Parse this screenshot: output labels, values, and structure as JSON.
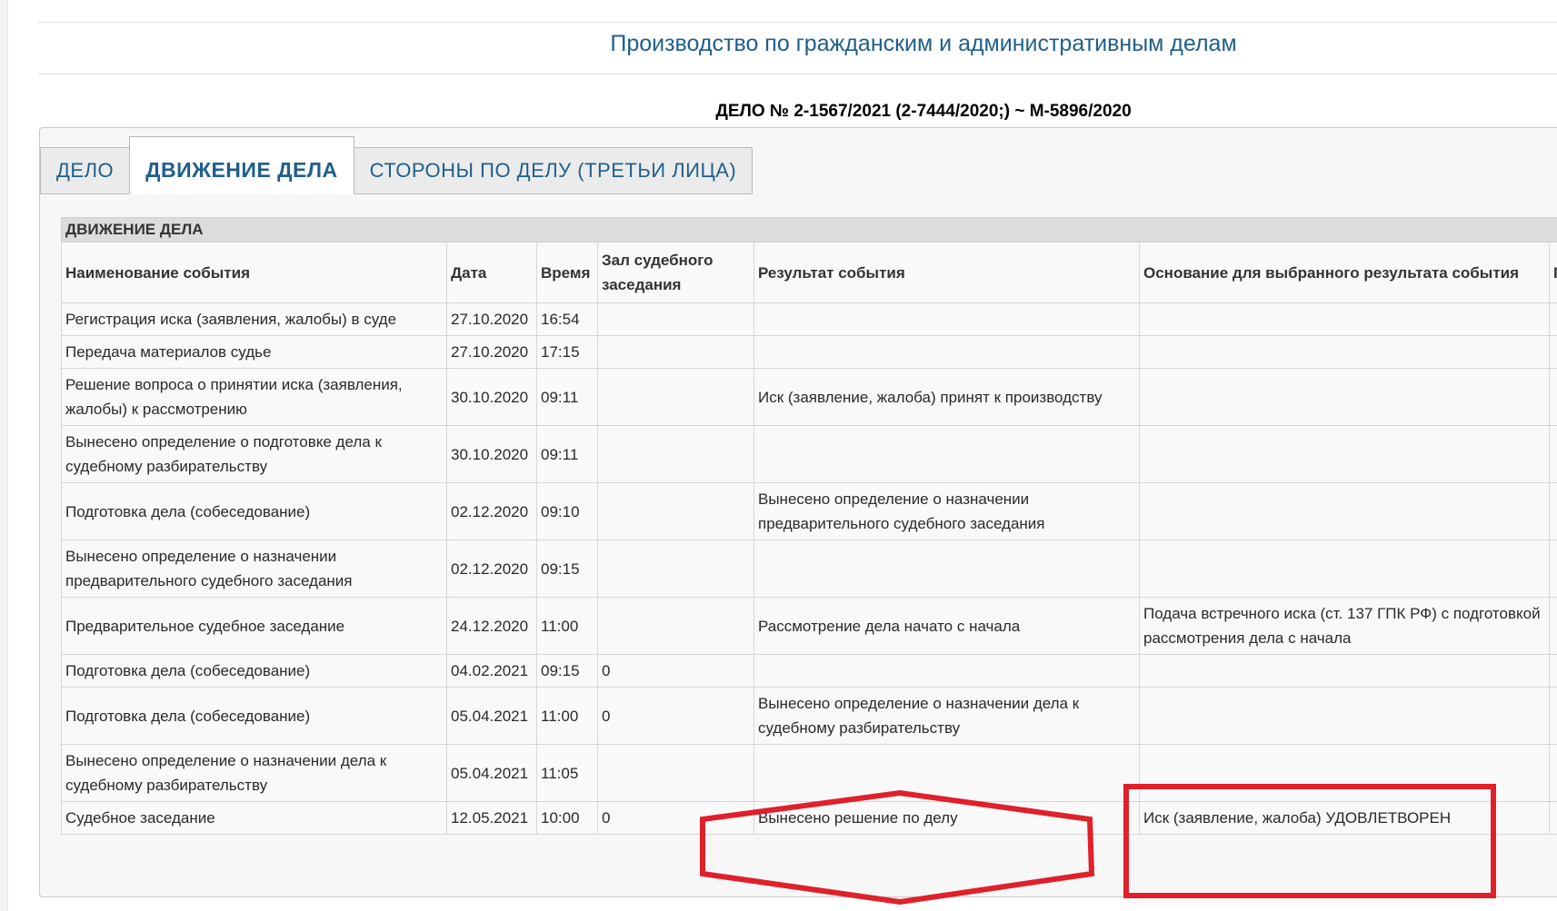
{
  "header": {
    "title": "Производство по гражданским и административным делам",
    "case_number": "ДЕЛО № 2-1567/2021 (2-7444/2020;) ~ М-5896/2020"
  },
  "tabs": [
    {
      "label": "ДЕЛО",
      "active": false
    },
    {
      "label": "ДВИЖЕНИЕ ДЕЛА",
      "active": true
    },
    {
      "label": "СТОРОНЫ ПО ДЕЛУ (ТРЕТЬИ ЛИЦА)",
      "active": false
    }
  ],
  "table": {
    "caption": "ДВИЖЕНИЕ ДЕЛА",
    "columns": [
      "Наименование события",
      "Дата",
      "Время",
      "Зал судебного заседания",
      "Результат события",
      "Основание для выбранного результата события",
      "П"
    ],
    "rows": [
      {
        "event": "Регистрация иска (заявления, жалобы) в суде",
        "date": "27.10.2020",
        "time": "16:54",
        "room": "",
        "result": "",
        "basis": ""
      },
      {
        "event": "Передача материалов судье",
        "date": "27.10.2020",
        "time": "17:15",
        "room": "",
        "result": "",
        "basis": ""
      },
      {
        "event": "Решение вопроса о принятии иска (заявления, жалобы) к рассмотрению",
        "date": "30.10.2020",
        "time": "09:11",
        "room": "",
        "result": "Иск (заявление, жалоба) принят к производству",
        "basis": ""
      },
      {
        "event": "Вынесено определение о подготовке дела к судебному разбирательству",
        "date": "30.10.2020",
        "time": "09:11",
        "room": "",
        "result": "",
        "basis": ""
      },
      {
        "event": "Подготовка дела (собеседование)",
        "date": "02.12.2020",
        "time": "09:10",
        "room": "",
        "result": "Вынесено определение о назначении предварительного судебного заседания",
        "basis": ""
      },
      {
        "event": "Вынесено определение о назначении предварительного судебного заседания",
        "date": "02.12.2020",
        "time": "09:15",
        "room": "",
        "result": "",
        "basis": ""
      },
      {
        "event": "Предварительное судебное заседание",
        "date": "24.12.2020",
        "time": "11:00",
        "room": "",
        "result": "Рассмотрение дела начато с начала",
        "basis": "Подача встречного иска (ст. 137 ГПК РФ) с подготовкой рассмотрения дела с начала"
      },
      {
        "event": "Подготовка дела (собеседование)",
        "date": "04.02.2021",
        "time": "09:15",
        "room": "0",
        "result": "",
        "basis": ""
      },
      {
        "event": "Подготовка дела (собеседование)",
        "date": "05.04.2021",
        "time": "11:00",
        "room": "0",
        "result": "Вынесено определение о назначении дела к судебному разбирательству",
        "basis": ""
      },
      {
        "event": "Вынесено определение о назначении дела к судебному разбирательству",
        "date": "05.04.2021",
        "time": "11:05",
        "room": "",
        "result": "",
        "basis": ""
      },
      {
        "event": "Судебное заседание",
        "date": "12.05.2021",
        "time": "10:00",
        "room": "0",
        "result": "Вынесено решение по делу",
        "basis": "Иск (заявление, жалоба) УДОВЛЕТВОРЕН"
      }
    ]
  },
  "colors": {
    "link": "#1f5f8b",
    "annotation": "#e0202a",
    "caption_bg": "#dcdcdc"
  }
}
